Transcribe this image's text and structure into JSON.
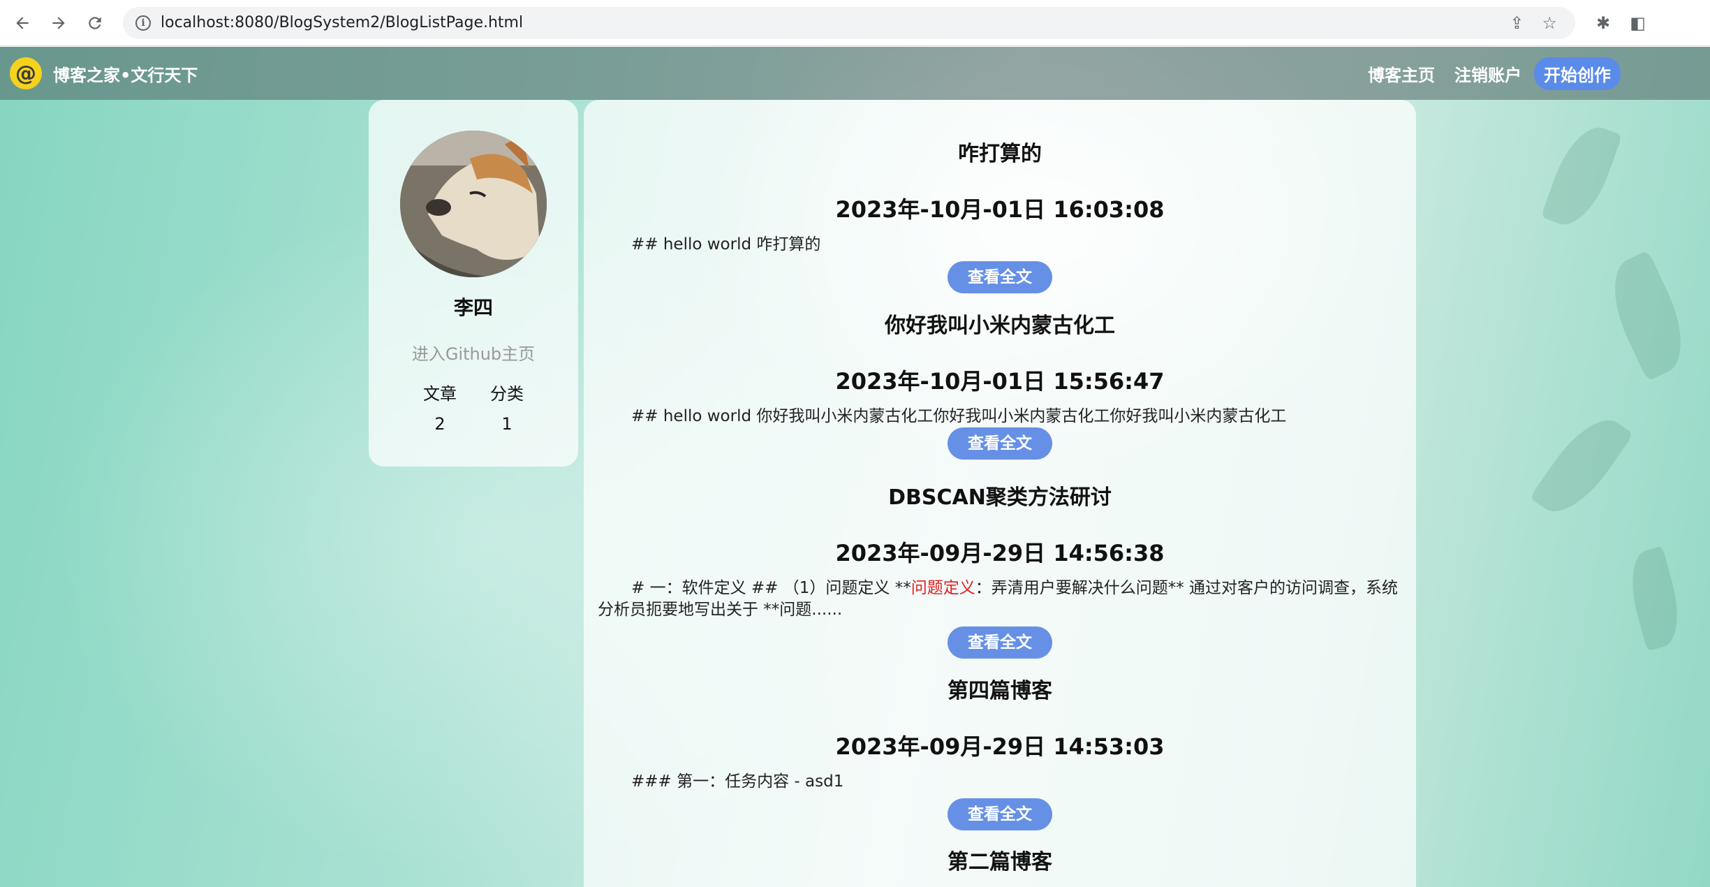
{
  "browser": {
    "url": "localhost:8080/BlogSystem2/BlogListPage.html"
  },
  "header": {
    "logo_text": "@",
    "site_title": "博客之家•文行天下",
    "nav": [
      {
        "label": "博客主页"
      },
      {
        "label": "注销账户"
      },
      {
        "label": "开始创作"
      }
    ]
  },
  "user": {
    "name": "李四",
    "github_label": "进入Github主页",
    "stats": {
      "articles_label": "文章",
      "categories_label": "分类",
      "articles_count": "2",
      "categories_count": "1"
    }
  },
  "blogs": [
    {
      "title": "咋打算的",
      "date": "2023年-10月-01日 16:03:08",
      "desc": "## hello world 咋打算的",
      "button": "查看全文"
    },
    {
      "title": "你好我叫小米内蒙古化工",
      "date": "2023年-10月-01日 15:56:47",
      "desc": "## hello world 你好我叫小米内蒙古化工你好我叫小米内蒙古化工你好我叫小米内蒙古化工",
      "button": "查看全文"
    },
    {
      "title": "DBSCAN聚类方法研讨",
      "date": "2023年-09月-29日 14:56:38",
      "desc_before": "# 一：软件定义 ## （1）问题定义 **",
      "desc_highlight": "问题定义",
      "desc_after": "：弄清用户要解决什么问题** 通过对客户的访问调查，系统分析员扼要地写出关于 **问题......",
      "button": "查看全文"
    },
    {
      "title": "第四篇博客",
      "date": "2023年-09月-29日 14:53:03",
      "desc": "### 第一：任务内容 - asd1",
      "button": "查看全文"
    },
    {
      "title": "第二篇博客"
    }
  ],
  "colors": {
    "accent": "#6690e6",
    "highlight": "#e02020",
    "logo": "#f5d21e"
  }
}
